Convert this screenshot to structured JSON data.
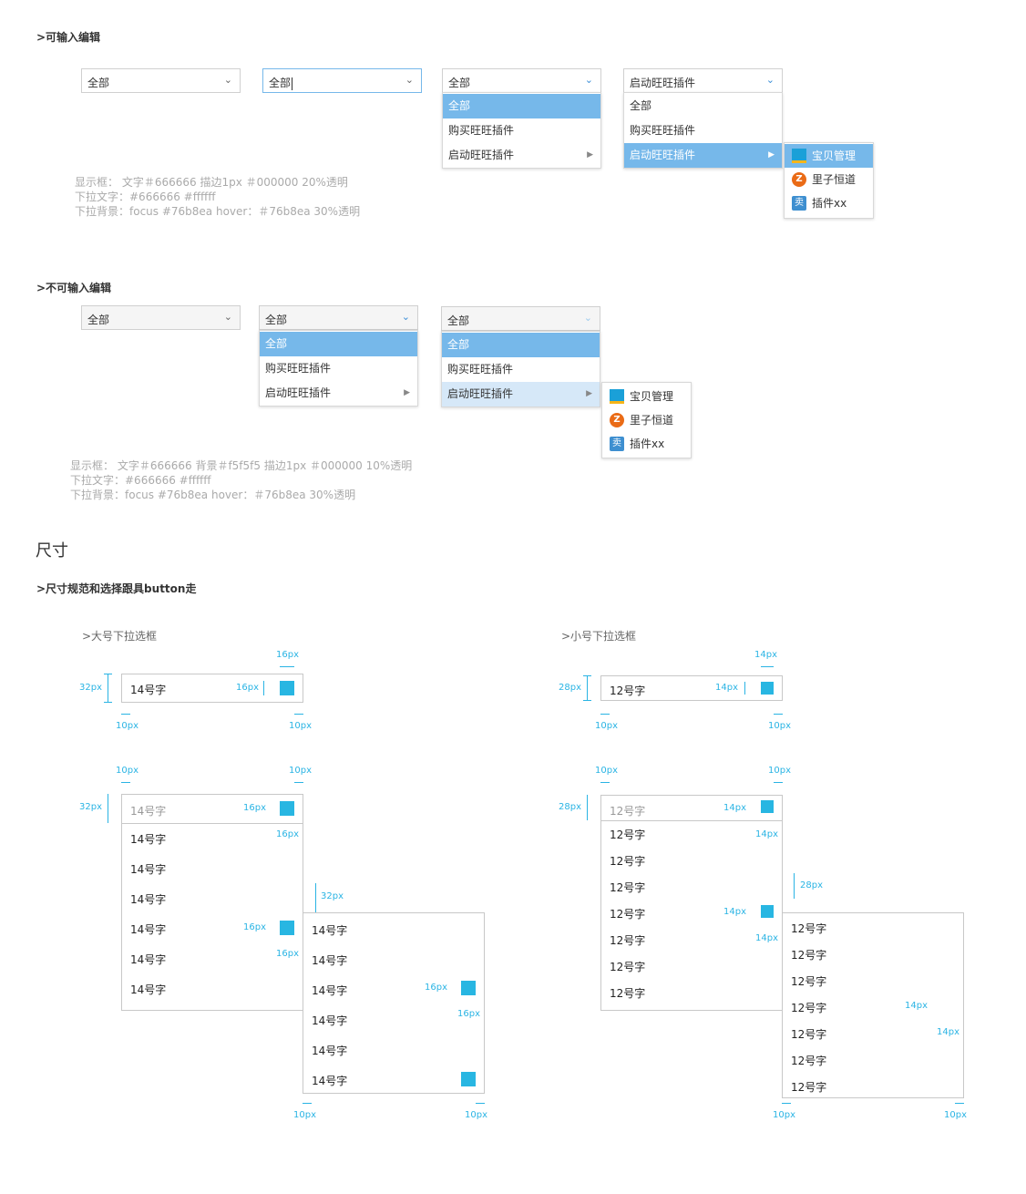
{
  "section_editable": {
    "title": ">可输入编辑",
    "box1_value": "全部",
    "box2_value": "全部",
    "box3_value": "全部",
    "box3_items": [
      "全部",
      "购买旺旺插件",
      "启动旺旺插件"
    ],
    "box4_value": "启动旺旺插件",
    "box4_items": [
      "全部",
      "购买旺旺插件",
      "启动旺旺插件"
    ],
    "submenu": [
      "宝贝管理",
      "里子恒道",
      "插件xx"
    ],
    "spec": [
      "显示框：  文字＃666666    描边1px   ＃000000   20%透明",
      "下拉文字：#666666       #ffffff",
      "下拉背景：focus #76b8ea       hover：＃76b8ea   30%透明"
    ]
  },
  "section_readonly": {
    "title": ">不可输入编辑",
    "box1_value": "全部",
    "box2_value": "全部",
    "box2_items": [
      "全部",
      "购买旺旺插件",
      "启动旺旺插件"
    ],
    "box3_value": "全部",
    "box3_items": [
      "全部",
      "购买旺旺插件",
      "启动旺旺插件"
    ],
    "submenu": [
      "宝贝管理",
      "里子恒道",
      "插件xx"
    ],
    "spec": [
      "显示框：  文字＃666666    背景＃f5f5f5   描边1px   ＃000000   10%透明",
      "下拉文字：#666666       #ffffff",
      "下拉背景：focus #76b8ea       hover：＃76b8ea   30%透明"
    ]
  },
  "size_section": {
    "title": "尺寸",
    "subtitle": ">尺寸规范和选择跟具button走",
    "large_label": ">大号下拉选框",
    "small_label": ">小号下拉选框",
    "large_text": "14号字",
    "small_text": "12号字",
    "dims": {
      "d32": "32px",
      "d28": "28px",
      "d16": "16px",
      "d14": "14px",
      "d10": "10px"
    }
  },
  "colors": {
    "focus": "#76b8ea",
    "measure": "#2ab4e4",
    "icon_square": "#28b6e2"
  }
}
